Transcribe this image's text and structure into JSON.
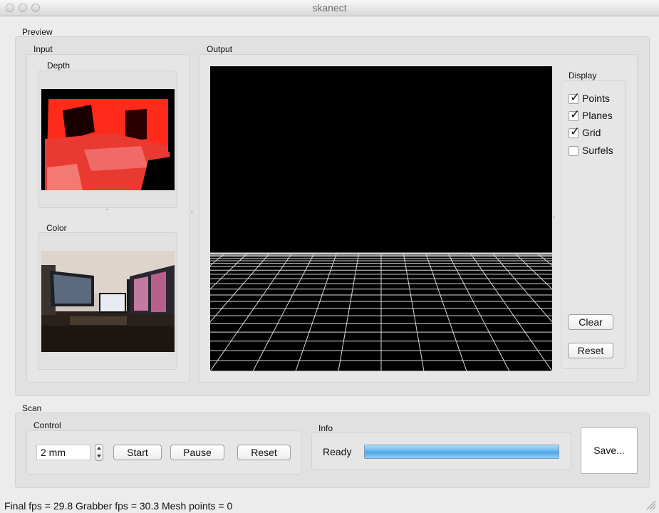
{
  "window": {
    "title": "skanect"
  },
  "preview": {
    "label": "Preview",
    "input": {
      "label": "Input",
      "depth_label": "Depth",
      "color_label": "Color"
    },
    "output": {
      "label": "Output",
      "display": {
        "label": "Display",
        "options": [
          {
            "label": "Points",
            "checked": true
          },
          {
            "label": "Planes",
            "checked": true
          },
          {
            "label": "Grid",
            "checked": true
          },
          {
            "label": "Surfels",
            "checked": false
          }
        ],
        "clear_label": "Clear",
        "reset_label": "Reset"
      }
    }
  },
  "scan": {
    "label": "Scan",
    "control": {
      "label": "Control",
      "resolution_value": "2 mm",
      "start_label": "Start",
      "pause_label": "Pause",
      "reset_label": "Reset"
    },
    "info": {
      "label": "Info",
      "status": "Ready",
      "progress": 1.0
    },
    "save_label": "Save..."
  },
  "status_bar": {
    "text": "Final fps = 29.8 Grabber fps = 30.3   Mesh points = 0"
  },
  "colors": {
    "progress_fill": "#6cb8ec",
    "viewport_bg": "#000000",
    "depth_red": "#ff2a1a"
  }
}
